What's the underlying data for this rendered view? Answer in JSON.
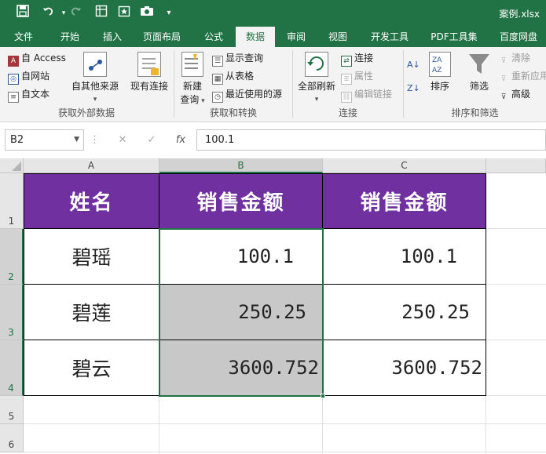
{
  "title_bar": {
    "qat": {
      "save_icon": "save-icon",
      "undo_icon": "undo-icon",
      "redo_icon": "redo-icon",
      "customize_icon": "chevron-down-icon"
    },
    "filename": "案例.xlsx"
  },
  "tabs": [
    "文件",
    "开始",
    "插入",
    "页面布局",
    "公式",
    "数据",
    "审阅",
    "视图",
    "开发工具",
    "PDF工具集",
    "百度网盘"
  ],
  "active_tab": "数据",
  "ribbon": {
    "get_external": {
      "access": "自 Access",
      "web": "自网站",
      "text": "自文本",
      "other_sources": "自其他来源",
      "existing": "现有连接",
      "label": "获取外部数据"
    },
    "get_transform": {
      "new_query_line1": "新建",
      "new_query_line2": "查询",
      "show_queries": "显示查询",
      "from_table": "从表格",
      "recent_sources": "最近使用的源",
      "label": "获取和转换"
    },
    "connections": {
      "refresh_all": "全部刷新",
      "connections": "连接",
      "properties": "属性",
      "edit_links": "编辑链接",
      "label": "连接"
    },
    "sort_filter": {
      "sort": "排序",
      "filter": "筛选",
      "clear": "清除",
      "reapply": "重新应用",
      "advanced": "高级",
      "label": "排序和筛选"
    }
  },
  "formula_bar": {
    "name_box": "B2",
    "cancel": "✕",
    "enter": "✓",
    "fx": "fx",
    "value": "100.1"
  },
  "columns": [
    "A",
    "B",
    "C"
  ],
  "rows": [
    "1",
    "2",
    "3",
    "4",
    "5",
    "6"
  ],
  "table": {
    "headers": [
      "姓名",
      "销售金额",
      "销售金额"
    ],
    "rows": [
      [
        "碧瑶",
        "100.1",
        "100.1"
      ],
      [
        "碧莲",
        "250.25",
        "250.25"
      ],
      [
        "碧云",
        "3600.752",
        "3600.752"
      ]
    ]
  },
  "colors": {
    "excel_green": "#217346",
    "header_purple": "#7030a0",
    "selection_fill": "#c8c8c8"
  }
}
